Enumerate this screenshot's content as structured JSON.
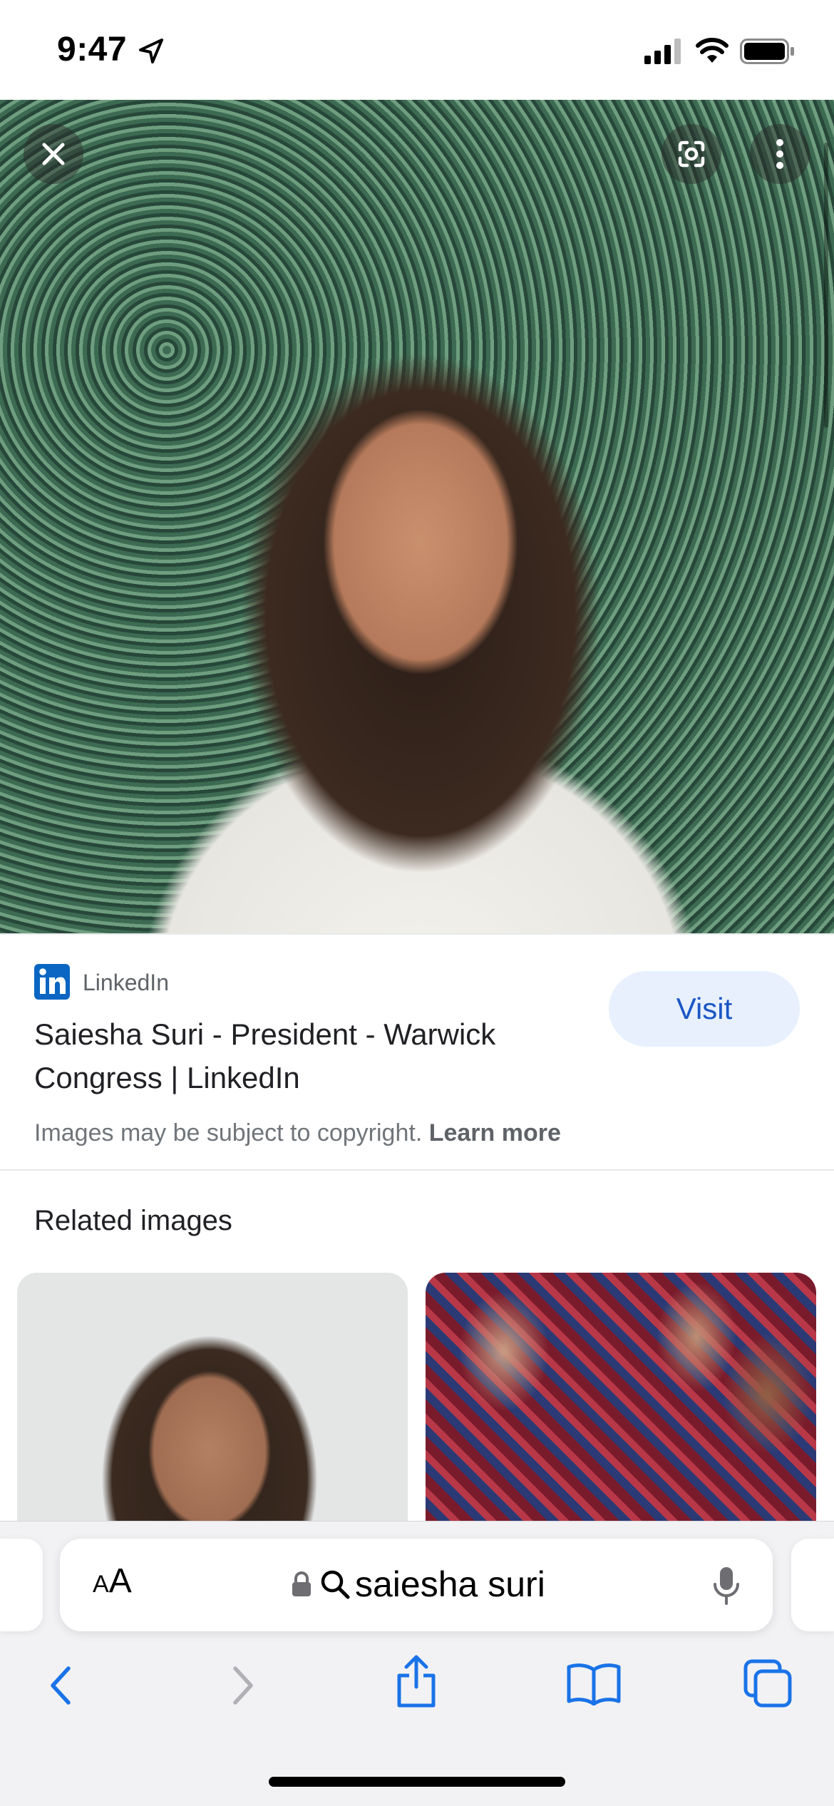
{
  "status_bar": {
    "time": "9:47"
  },
  "result": {
    "source": "LinkedIn",
    "title": "Saiesha Suri - President - Warwick Congress | LinkedIn",
    "visit_label": "Visit",
    "copyright_text": "Images may be subject to copyright.",
    "learn_more_label": "Learn more"
  },
  "related": {
    "heading": "Related images"
  },
  "browser": {
    "aa_small": "A",
    "aa_large": "A",
    "query": "saiesha suri"
  },
  "colors": {
    "accent": "#1a73e8",
    "visit_bg": "#e8f0fe",
    "linkedin": "#0a66c2"
  }
}
